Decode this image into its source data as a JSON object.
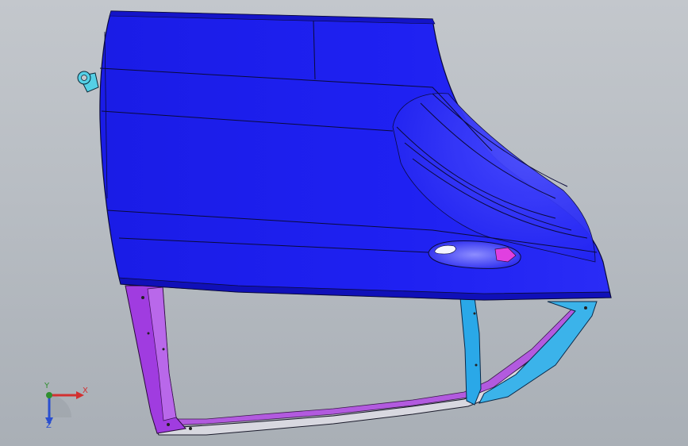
{
  "viewport": {
    "background_top": "#c3c7cc",
    "background_bottom": "#a9afb6"
  },
  "model": {
    "description_icon": "car-door-assembly",
    "colors": {
      "outer_panel": "#1c1ef0",
      "outer_panel_highlight": "#5b5cff",
      "hinge_pillar": "#a03ce0",
      "b_pillar": "#2aa8e8",
      "frame_sill": "#b25adf",
      "handle_latch": "#e040e0",
      "bracket": "#55d0e6",
      "edge": "#0a0a3a"
    }
  },
  "triad": {
    "x_label": "X",
    "y_label": "Y",
    "z_label": "Z",
    "x_color": "#d23030",
    "y_color": "#2f8f2f",
    "z_color": "#2a4fd0"
  }
}
